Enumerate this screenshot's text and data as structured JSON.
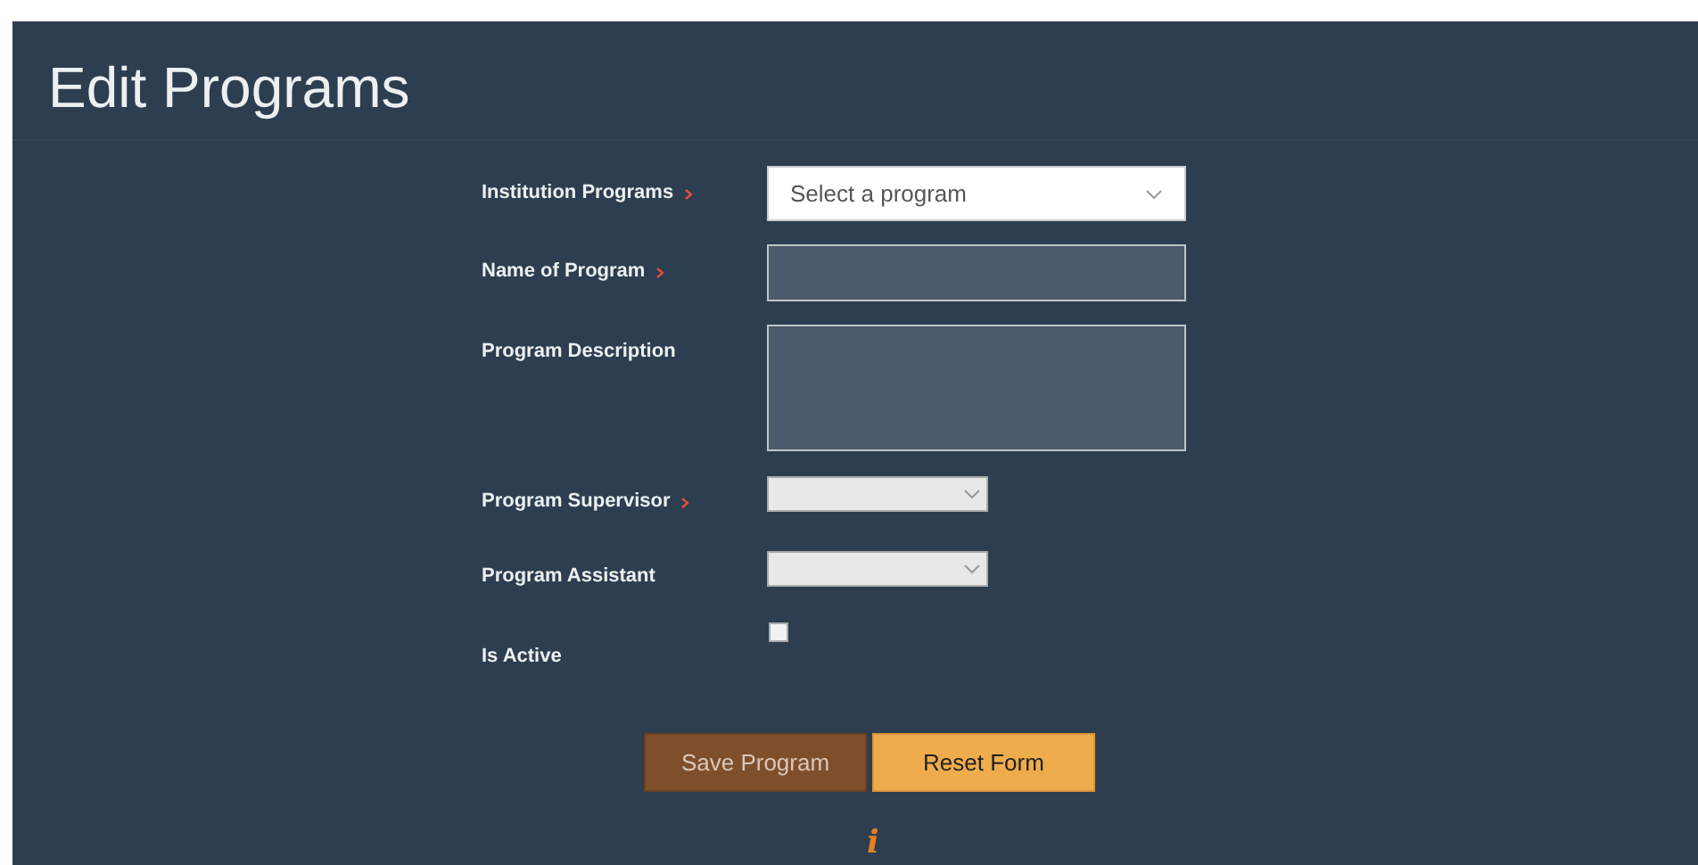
{
  "page": {
    "title": "Edit Programs"
  },
  "fields": [
    {
      "label": "Institution Programs",
      "required": true,
      "kind": "select",
      "placeholder": "Select a program"
    },
    {
      "label": "Name of Program",
      "required": true,
      "kind": "text"
    },
    {
      "label": "Program Description",
      "required": false,
      "kind": "textarea"
    },
    {
      "label": "Program Supervisor",
      "required": true,
      "kind": "small-select"
    },
    {
      "label": "Program Assistant",
      "required": false,
      "kind": "small-select"
    },
    {
      "label": "Is Active",
      "required": false,
      "kind": "checkbox",
      "checked": false
    }
  ],
  "buttons": [
    {
      "label": "Save Program",
      "kind": "primary"
    },
    {
      "label": "Reset Form",
      "kind": "secondary"
    }
  ],
  "info_glyph": "i"
}
